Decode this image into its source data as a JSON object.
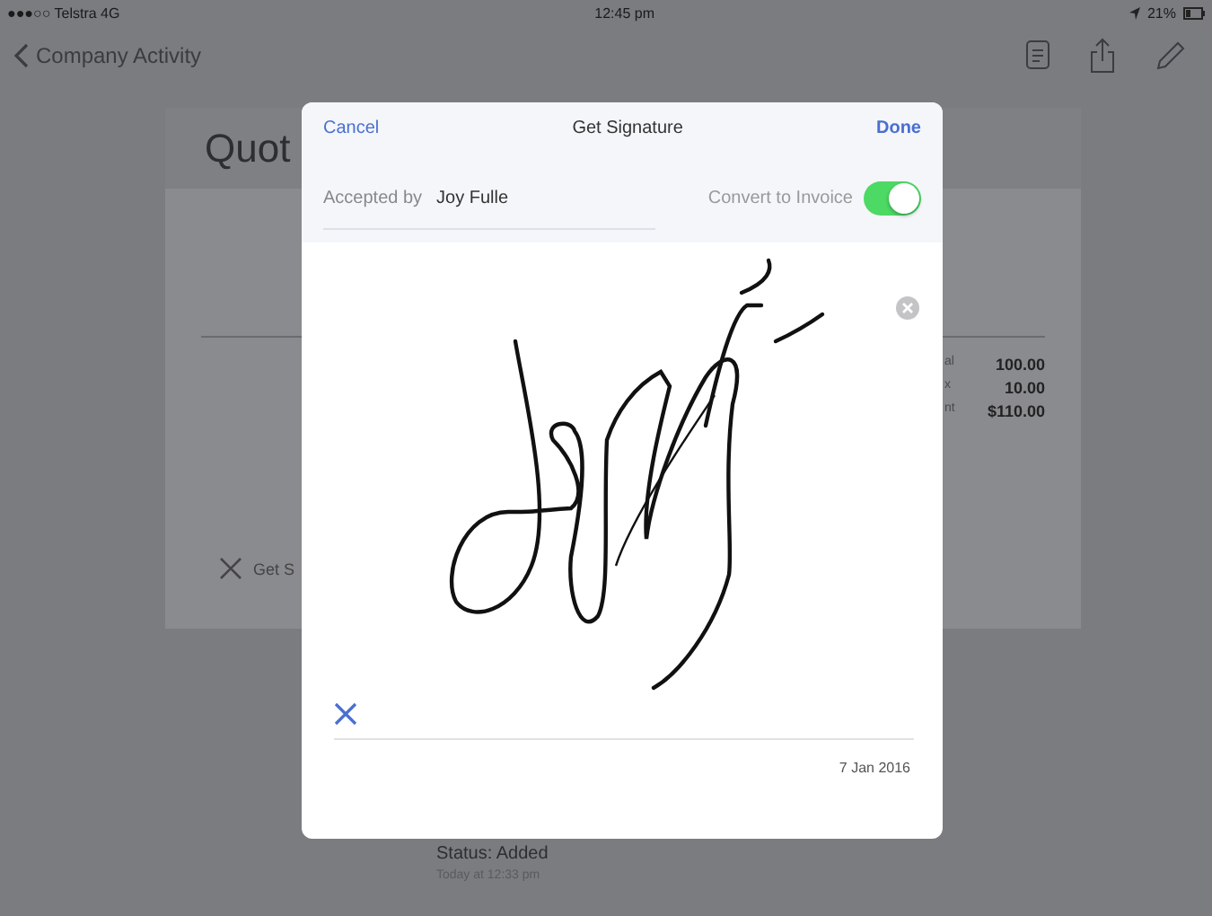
{
  "status_bar": {
    "carrier": "●●●○○ Telstra  4G",
    "time": "12:45 pm",
    "battery": "21%"
  },
  "nav_bar": {
    "back_label": "Company Activity"
  },
  "quote_card": {
    "title": "Quot",
    "totals": [
      {
        "label": "al",
        "value": "100.00"
      },
      {
        "label": "x",
        "value": "10.00"
      },
      {
        "label": "nt",
        "value": "$110.00"
      }
    ],
    "get_signature_label": "Get S"
  },
  "activity": {
    "status": "Status: Added",
    "time": "Today at 12:33 pm"
  },
  "signature_dialog": {
    "cancel": "Cancel",
    "title": "Get Signature",
    "done": "Done",
    "accepted_by_label": "Accepted by",
    "accepted_by_value": "Joy Fulle",
    "convert_label": "Convert to Invoice",
    "convert_on": true,
    "date": "7 Jan 2016"
  }
}
